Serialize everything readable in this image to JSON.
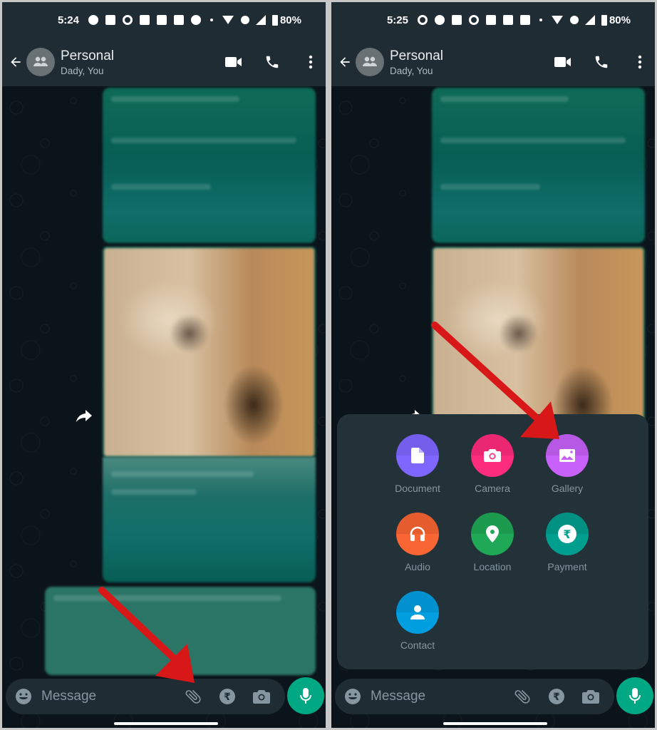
{
  "left": {
    "status": {
      "time": "5:24",
      "battery": "80%"
    },
    "header": {
      "title": "Personal",
      "subtitle": "Dady, You"
    },
    "input": {
      "placeholder": "Message"
    },
    "annotation": "Red arrow pointing to attach (paperclip) icon"
  },
  "right": {
    "status": {
      "time": "5:25",
      "battery": "80%"
    },
    "header": {
      "title": "Personal",
      "subtitle": "Dady, You"
    },
    "input": {
      "placeholder": "Message"
    },
    "attach_menu": {
      "items": [
        {
          "label": "Document",
          "icon": "document-icon",
          "color": "#7f66ff"
        },
        {
          "label": "Camera",
          "icon": "camera-icon",
          "color": "#fe2c7c"
        },
        {
          "label": "Gallery",
          "icon": "gallery-icon",
          "color": "#c861f9"
        },
        {
          "label": "Audio",
          "icon": "headphones-icon",
          "color": "#f96533"
        },
        {
          "label": "Location",
          "icon": "location-pin-icon",
          "color": "#1fa855"
        },
        {
          "label": "Payment",
          "icon": "rupee-icon",
          "color": "#009e8f"
        },
        {
          "label": "Contact",
          "icon": "contact-icon",
          "color": "#019ee0"
        }
      ]
    },
    "annotation": "Red arrow pointing to Gallery option"
  },
  "colors": {
    "header_bg": "#1f2c34",
    "chat_bg": "#0b141a",
    "accent": "#00a884",
    "arrow": "#d81818"
  }
}
